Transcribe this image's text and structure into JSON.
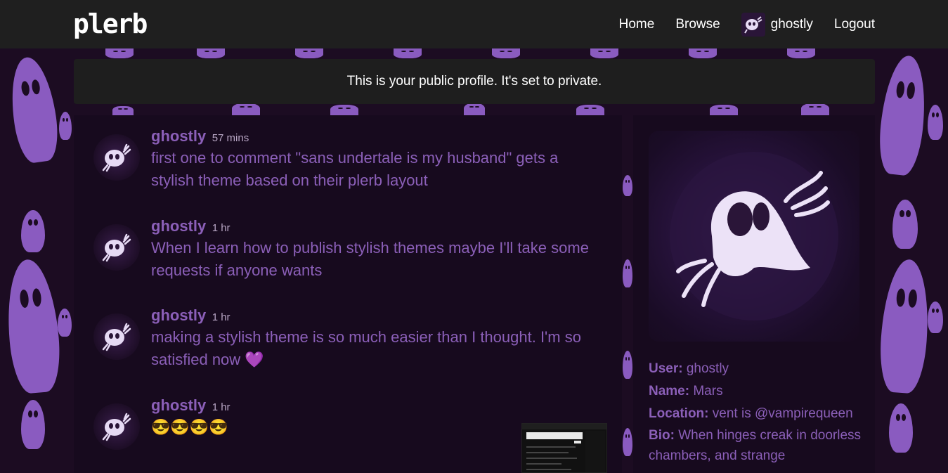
{
  "app": {
    "logo": "plerb"
  },
  "nav": {
    "home": "Home",
    "browse": "Browse",
    "user": "ghostly",
    "logout": "Logout"
  },
  "notice": "This is your public profile. It's set to private.",
  "posts": [
    {
      "user": "ghostly",
      "time": "57 mins",
      "text": "first one to comment \"sans undertale is my husband\" gets a stylish theme based on their plerb layout"
    },
    {
      "user": "ghostly",
      "time": "1 hr",
      "text": "When I learn how to publish stylish themes maybe I'll take some requests if anyone wants"
    },
    {
      "user": "ghostly",
      "time": "1 hr",
      "text": "making a stylish theme is so much easier than I thought. I'm so satisfied now 💜"
    },
    {
      "user": "ghostly",
      "time": "1 hr",
      "text": "😎😎😎😎"
    }
  ],
  "profile": {
    "user_label": "User:",
    "user": "ghostly",
    "name_label": "Name:",
    "name": "Mars",
    "location_label": "Location:",
    "location": "vent is @vampirequeen",
    "bio_label": "Bio:",
    "bio": "When hinges creak in doorless chambers, and strange"
  },
  "colors": {
    "accent": "#8b5fb8",
    "background": "#1c0c22",
    "panel": "#170a1e",
    "topbar": "#1f1f1f"
  }
}
